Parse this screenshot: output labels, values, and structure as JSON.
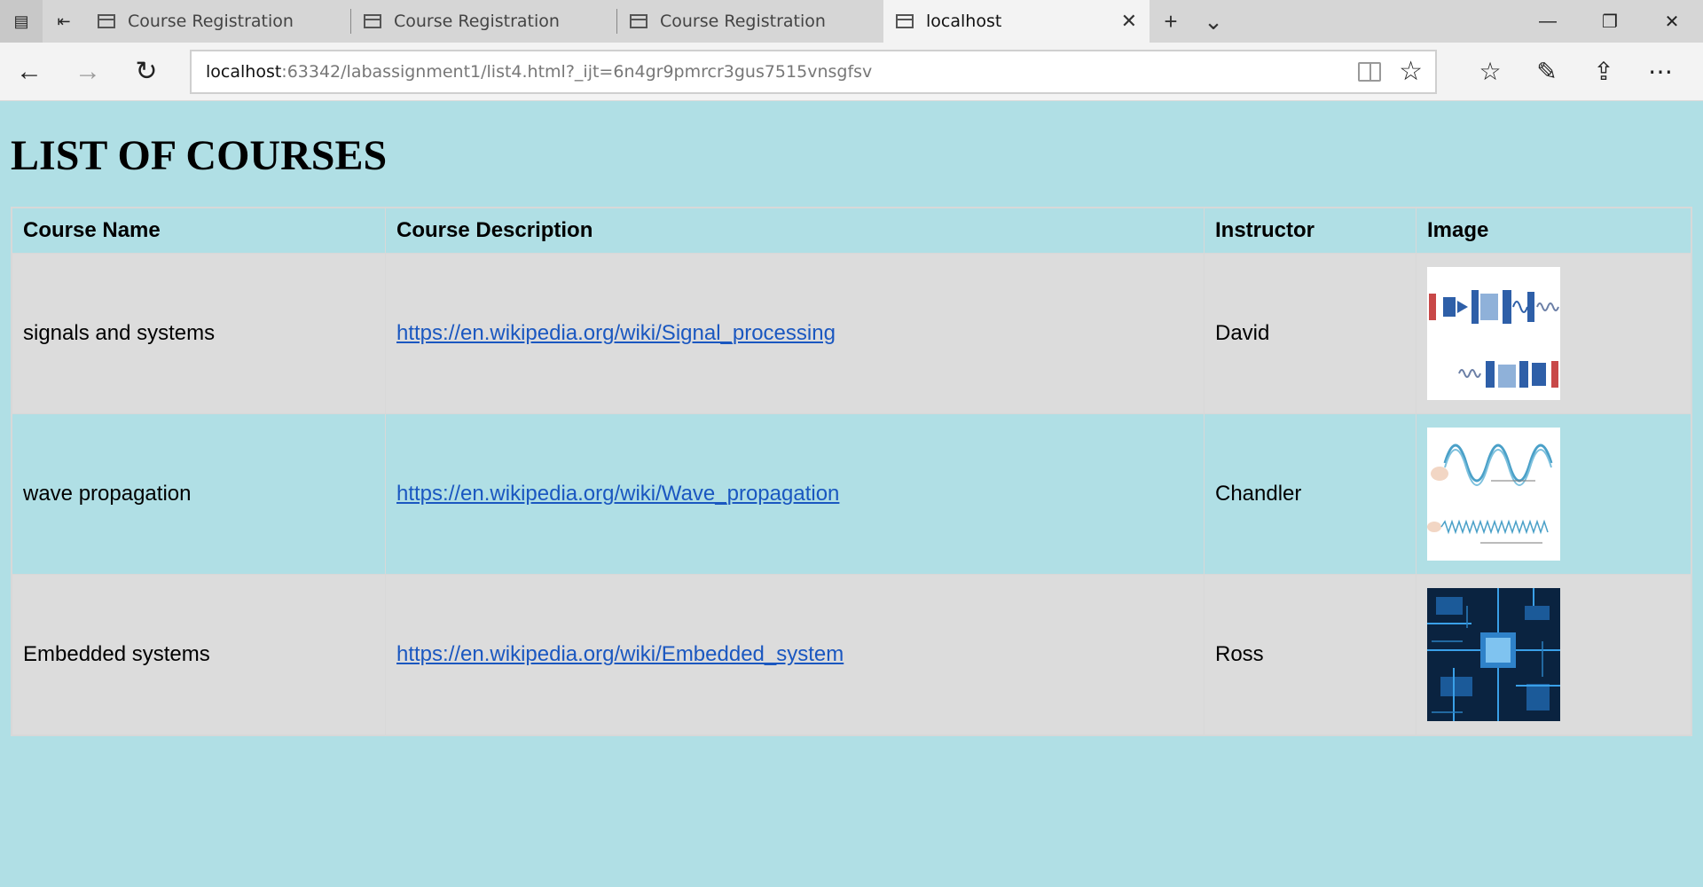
{
  "browser": {
    "tabs": [
      {
        "title": "Course Registration",
        "active": false
      },
      {
        "title": "Course Registration",
        "active": false
      },
      {
        "title": "Course Registration",
        "active": false
      },
      {
        "title": "localhost",
        "active": true
      }
    ],
    "address": {
      "host": "localhost",
      "rest": ":63342/labassignment1/list4.html?_ijt=6n4gr9pmrcr3gus7515vnsgfsv"
    }
  },
  "page": {
    "title": "LIST OF COURSES",
    "table": {
      "headers": [
        "Course Name",
        "Course Description",
        "Instructor",
        "Image"
      ],
      "rows": [
        {
          "name": "signals and systems",
          "link": "https://en.wikipedia.org/wiki/Signal_processing",
          "instructor": "David",
          "image": "signal-processing-diagram"
        },
        {
          "name": "wave propagation",
          "link": "https://en.wikipedia.org/wiki/Wave_propagation",
          "instructor": "Chandler",
          "image": "wave-diagram"
        },
        {
          "name": "Embedded systems",
          "link": "https://en.wikipedia.org/wiki/Embedded_system",
          "instructor": "Ross",
          "image": "circuit-board-photo"
        }
      ]
    }
  },
  "colors": {
    "page_bg": "#b0dfe5",
    "row_alt": "#dcdcdc",
    "link": "#1a57c0"
  }
}
